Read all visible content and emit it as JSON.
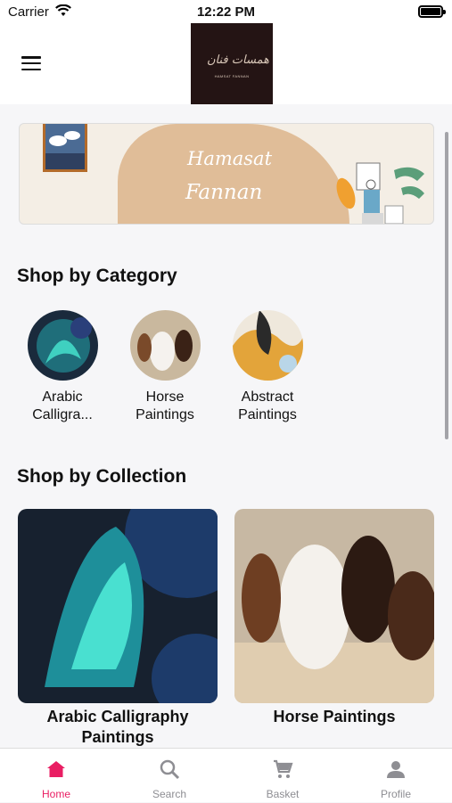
{
  "status_bar": {
    "carrier": "Carrier",
    "time": "12:22 PM"
  },
  "header": {
    "logo_script": "همسات فنان",
    "logo_text": "HAMSAT FANNAN"
  },
  "banner": {
    "line1": "Hamasat",
    "line2": "Fannan"
  },
  "categories": {
    "title": "Shop by Category",
    "items": [
      {
        "label": "Arabic Calligra..."
      },
      {
        "label": "Horse Paintings"
      },
      {
        "label": "Abstract Paintings"
      }
    ]
  },
  "collections": {
    "title": "Shop by Collection",
    "items": [
      {
        "label": "Arabic Calligraphy Paintings"
      },
      {
        "label": "Horse Paintings"
      }
    ]
  },
  "tabs": [
    {
      "label": "Home",
      "icon": "home-icon",
      "active": true
    },
    {
      "label": "Search",
      "icon": "search-icon",
      "active": false
    },
    {
      "label": "Basket",
      "icon": "cart-icon",
      "active": false
    },
    {
      "label": "Profile",
      "icon": "person-icon",
      "active": false
    }
  ],
  "colors": {
    "accent": "#e91e63",
    "inactive": "#8e8e93",
    "logo_bg": "#241414"
  }
}
